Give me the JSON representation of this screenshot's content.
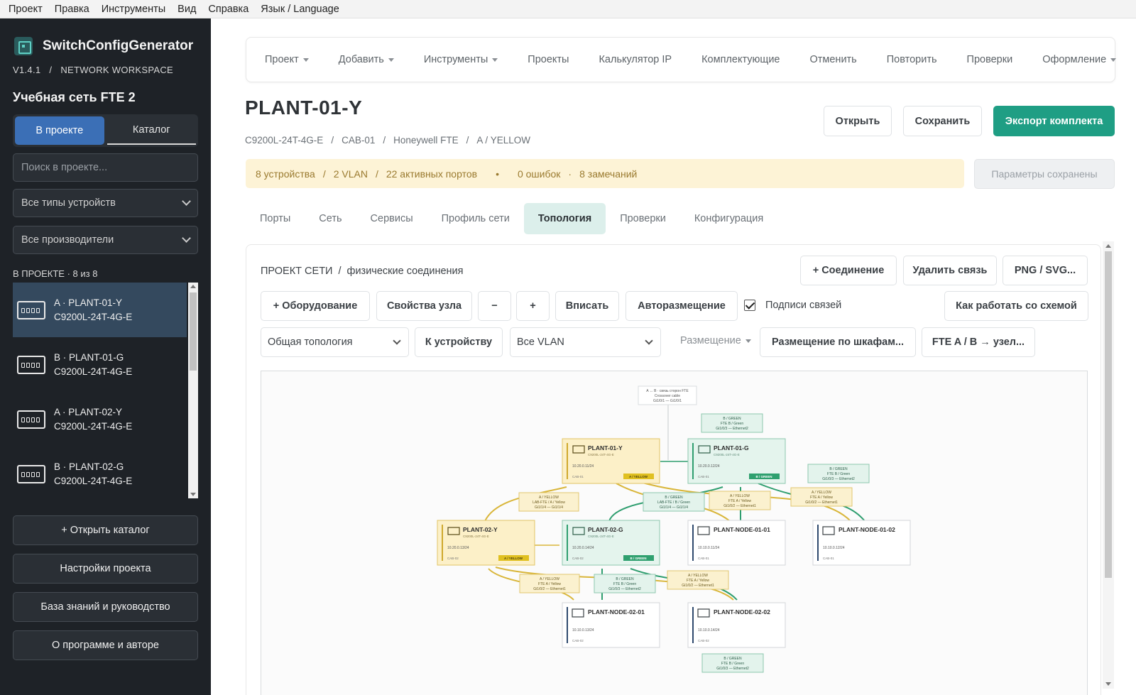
{
  "menubar": {
    "items": [
      "Проект",
      "Правка",
      "Инструменты",
      "Вид",
      "Справка",
      "Язык / Language"
    ]
  },
  "sidebar": {
    "app_name": "SwitchConfigGenerator",
    "version": "V1.4.1",
    "workspace": "NETWORK WORKSPACE",
    "project_title": "Учебная сеть FTE 2",
    "segment": {
      "in_project": "В проекте",
      "catalog": "Каталог"
    },
    "search_placeholder": "Поиск в проекте...",
    "filter_type": "Все типы устройств",
    "filter_vendor": "Все производители",
    "in_project_count": "В ПРОЕКТЕ · 8 из 8",
    "devices": [
      {
        "line1": "A · PLANT-01-Y",
        "line2": "C9200L-24T-4G-E"
      },
      {
        "line1": "B · PLANT-01-G",
        "line2": "C9200L-24T-4G-E"
      },
      {
        "line1": "A · PLANT-02-Y",
        "line2": "C9200L-24T-4G-E"
      },
      {
        "line1": "B · PLANT-02-G",
        "line2": "C9200L-24T-4G-E"
      }
    ],
    "buttons": {
      "open_catalog": "+  Открыть каталог",
      "project_settings": "Настройки проекта",
      "knowledge": "База знаний и руководство",
      "about": "О программе и авторе"
    }
  },
  "nav": {
    "project": "Проект",
    "add": "Добавить",
    "tools": "Инструменты",
    "projects": "Проекты",
    "ip_calc": "Калькулятор IP",
    "components": "Комплектующие",
    "undo": "Отменить",
    "redo": "Повторить",
    "checks": "Проверки",
    "design": "Оформление"
  },
  "device": {
    "title": "PLANT-01-Y",
    "model": "C9200L-24T-4G-E",
    "cabinet": "CAB-01",
    "system": "Honeywell FTE",
    "network": "A / YELLOW"
  },
  "actions": {
    "open": "Открыть",
    "save": "Сохранить",
    "export": "Экспорт комплекта"
  },
  "status": {
    "devices": "8 устройства",
    "vlan": "2 VLAN",
    "ports": "22 активных портов",
    "bullet": "•",
    "errors": "0 ошибок",
    "dot": "·",
    "warnings": "8 замечаний",
    "saved": "Параметры сохранены"
  },
  "tabs": [
    "Порты",
    "Сеть",
    "Сервисы",
    "Профиль сети",
    "Топология",
    "Проверки",
    "Конфигурация"
  ],
  "topology": {
    "crumb_a": "ПРОЕКТ СЕТИ",
    "crumb_b": "физические соединения",
    "add_link": "+ Соединение",
    "delete_link": "Удалить связь",
    "export_img": "PNG / SVG...",
    "add_equipment": "+ Оборудование",
    "node_props": "Свойства узла",
    "zoom_out": "−",
    "zoom_in": "+",
    "fit": "Вписать",
    "auto_layout": "Авторазмещение",
    "link_labels": "Подписи связей",
    "how_to": "Как работать со схемой",
    "view_select": "Общая топология",
    "to_device": "К устройству",
    "vlan_select": "Все VLAN",
    "placement": "Размещение",
    "cabinet_layout": "Размещение по шкафам...",
    "fte_node": "FTE A / B → узел...",
    "nodes": {
      "p01y": {
        "name": "PLANT-01-Y",
        "model": "C9200L-24T-4G-E",
        "ip": "10.20.0.11/24",
        "cab": "CAB-01",
        "tag": "A / YELLOW"
      },
      "p01g": {
        "name": "PLANT-01-G",
        "model": "C9200L-24T-4G-E",
        "ip": "10.20.0.12/24",
        "cab": "CAB-01",
        "tag": "B / GREEN"
      },
      "p02y": {
        "name": "PLANT-02-Y",
        "model": "C9200L-24T-4G-E",
        "ip": "10.20.0.13/24",
        "cab": "CAB-02",
        "tag": "A / YELLOW"
      },
      "p02g": {
        "name": "PLANT-02-G",
        "model": "C9200L-24T-4G-E",
        "ip": "10.20.0.14/24",
        "cab": "CAB-02",
        "tag": "B / GREEN"
      },
      "n0101": {
        "name": "PLANT-NODE-01-01",
        "ip": "10.10.0.11/24",
        "cab": "CAB-01"
      },
      "n0102": {
        "name": "PLANT-NODE-01-02",
        "ip": "10.10.0.12/24",
        "cab": "CAB-01"
      },
      "n0201": {
        "name": "PLANT-NODE-02-01",
        "ip": "10.10.0.13/24",
        "cab": "CAB-02"
      },
      "n0202": {
        "name": "PLANT-NODE-02-02",
        "ip": "10.10.0.14/24",
        "cab": "CAB-02"
      }
    },
    "labels": {
      "crossover": {
        "l1": "A ↔ B · связь сторон FTE",
        "l2": "Crossover cable",
        "l3": "Gi1/0/1 — Gi1/0/1"
      },
      "y_trunk": {
        "l1": "A / YELLOW",
        "l2": "LAB-FTE / A / Yellow",
        "l3": "Gi1/1/4 — Gi1/1/4"
      },
      "g_trunk": {
        "l1": "B / GREEN",
        "l2": "LAB-FTE / B / Green",
        "l3": "Gi1/1/4 — Gi1/1/4"
      },
      "y_node": {
        "l1": "A / YELLOW",
        "l2": "FTE A / Yellow",
        "l3": "Gi1/0/2 — Ethernet1"
      },
      "g_node": {
        "l1": "B / GREEN",
        "l2": "FTE B / Green",
        "l3": "Gi1/0/3 — Ethernet2"
      }
    }
  },
  "colors": {
    "accent": "#1f9e84",
    "yellow": "#d9b63a",
    "green": "#2f9e6f",
    "sidebar": "#1e2227"
  }
}
